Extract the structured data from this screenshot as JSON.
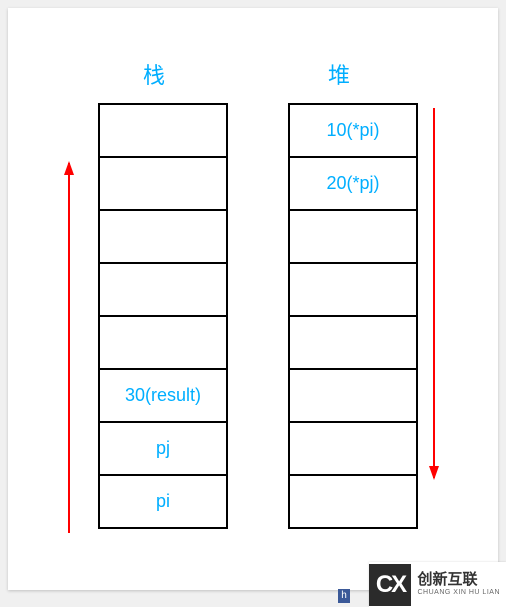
{
  "titles": {
    "stack": "栈",
    "heap": "堆"
  },
  "stack_cells": [
    "",
    "",
    "",
    "",
    "",
    "30(result)",
    "pj",
    "pi"
  ],
  "heap_cells": [
    "10(*pi)",
    "20(*pj)",
    "",
    "",
    "",
    "",
    "",
    ""
  ],
  "logo": {
    "mark": "CX",
    "cn": "创新互联",
    "en": "CHUANG XIN HU LIAN"
  },
  "tag": "h",
  "chart_data": {
    "type": "table",
    "description": "Memory layout diagram showing stack and heap regions",
    "stack": {
      "label": "栈",
      "direction": "up",
      "cells_top_to_bottom": [
        "",
        "",
        "",
        "",
        "",
        "30(result)",
        "pj",
        "pi"
      ]
    },
    "heap": {
      "label": "堆",
      "direction": "down",
      "cells_top_to_bottom": [
        "10(*pi)",
        "20(*pj)",
        "",
        "",
        "",
        "",
        "",
        ""
      ]
    }
  }
}
